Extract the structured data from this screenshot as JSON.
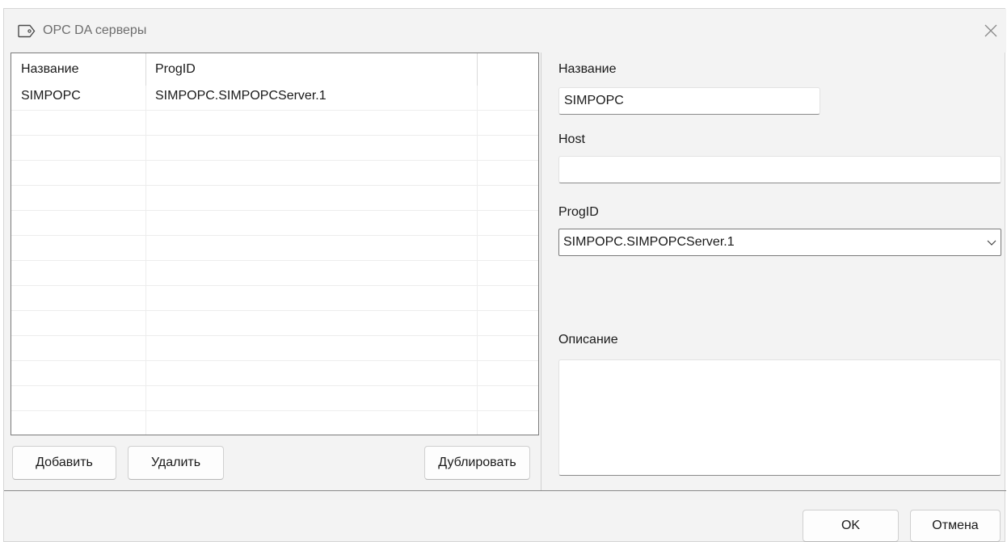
{
  "window": {
    "title": "OPC DA серверы"
  },
  "grid": {
    "columns": [
      "Название",
      "ProgID",
      ""
    ],
    "rows": [
      [
        "SIMPOPC",
        "SIMPOPC.SIMPOPCServer.1",
        ""
      ],
      [
        "",
        "",
        ""
      ],
      [
        "",
        "",
        ""
      ],
      [
        "",
        "",
        ""
      ],
      [
        "",
        "",
        ""
      ],
      [
        "",
        "",
        ""
      ],
      [
        "",
        "",
        ""
      ],
      [
        "",
        "",
        ""
      ],
      [
        "",
        "",
        ""
      ],
      [
        "",
        "",
        ""
      ],
      [
        "",
        "",
        ""
      ],
      [
        "",
        "",
        ""
      ],
      [
        "",
        "",
        ""
      ],
      [
        "",
        "",
        ""
      ]
    ]
  },
  "buttons": {
    "add": "Добавить",
    "delete": "Удалить",
    "duplicate": "Дублировать",
    "ok": "OK",
    "cancel": "Отмена"
  },
  "form": {
    "name_label": "Название",
    "name_value": "SIMPOPC",
    "host_label": "Host",
    "host_value": "",
    "progid_label": "ProgID",
    "progid_value": "SIMPOPC.SIMPOPCServer.1",
    "description_label": "Описание",
    "description_value": ""
  },
  "icons": {
    "title": "tag-icon",
    "close": "close-icon",
    "dropdown": "chevron-down-icon"
  }
}
